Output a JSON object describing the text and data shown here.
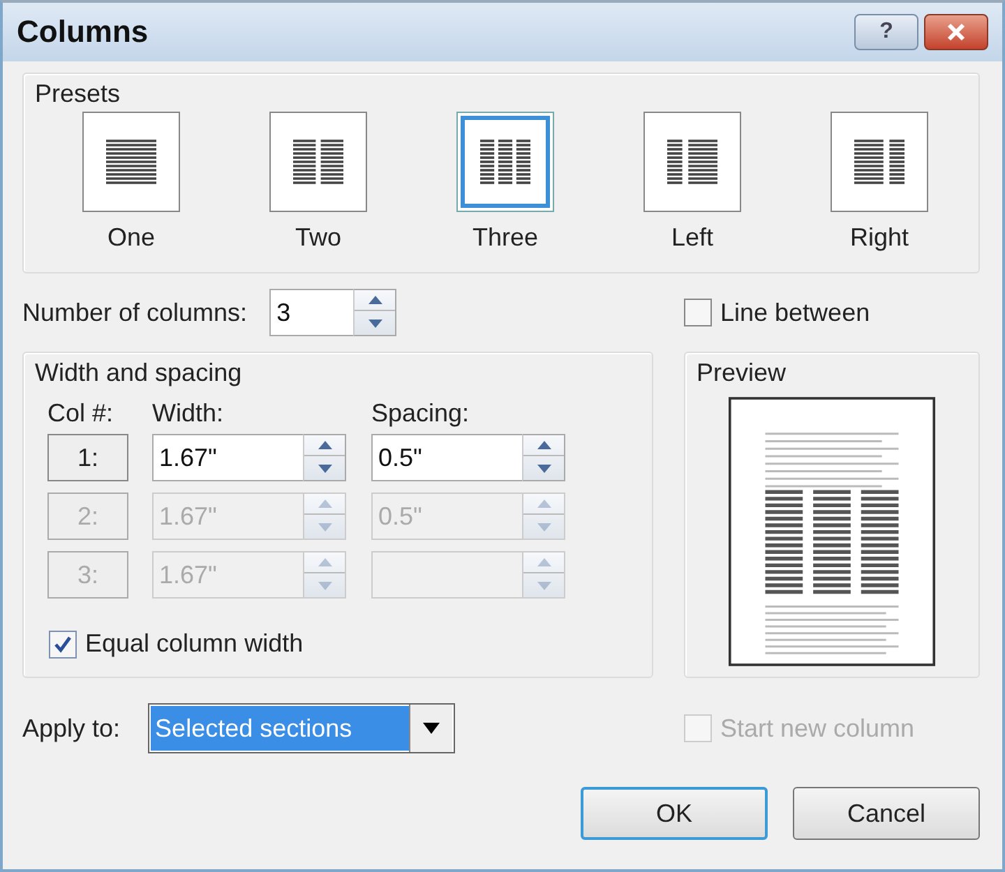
{
  "window": {
    "title": "Columns",
    "help_button": "?"
  },
  "presets": {
    "title": "Presets",
    "items": [
      {
        "kind": "one",
        "label": "One",
        "selected": false
      },
      {
        "kind": "two",
        "label": "Two",
        "selected": false
      },
      {
        "kind": "three",
        "label": "Three",
        "selected": true
      },
      {
        "kind": "left",
        "label": "Left",
        "selected": false
      },
      {
        "kind": "right",
        "label": "Right",
        "selected": false
      }
    ]
  },
  "number_of_columns": {
    "label": "Number of columns:",
    "value": "3"
  },
  "line_between": {
    "label": "Line between",
    "checked": false
  },
  "width_and_spacing": {
    "title": "Width and spacing",
    "headers": [
      "Col #:",
      "Width:",
      "Spacing:"
    ],
    "rows": [
      {
        "col": "1:",
        "width": "1.67\"",
        "spacing": "0.5\"",
        "disabled": false
      },
      {
        "col": "2:",
        "width": "1.67\"",
        "spacing": "0.5\"",
        "disabled": true
      },
      {
        "col": "3:",
        "width": "1.67\"",
        "disabled": true
      }
    ],
    "equal_column_width": {
      "label": "Equal column width",
      "checked": true
    }
  },
  "preview": {
    "title": "Preview"
  },
  "apply_to": {
    "label": "Apply to:",
    "value": "Selected sections"
  },
  "start_new_column": {
    "label": "Start new column",
    "checked": false,
    "disabled": true
  },
  "buttons": [
    {
      "label": "OK",
      "default": true
    },
    {
      "label": "Cancel",
      "default": false
    }
  ]
}
